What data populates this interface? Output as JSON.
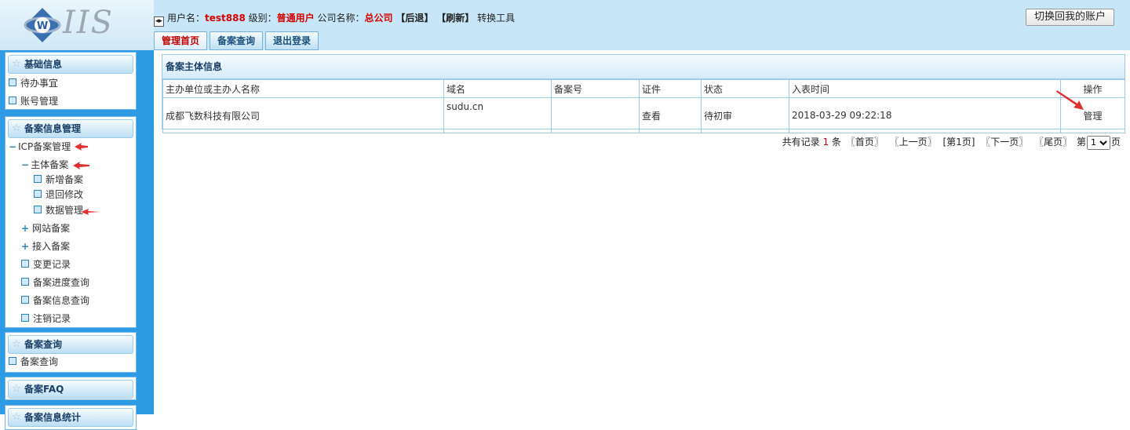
{
  "header": {
    "logo_text": "IIS",
    "user_label": "用户名：",
    "username": "test888",
    "level_label": "级别：",
    "level": "普通用户",
    "company_label": "公司名称：",
    "company": "总公司",
    "back": "【后退】",
    "refresh": "【刷新】",
    "convert": "转换工具",
    "switch_account": "切换回我的账户"
  },
  "tabs": [
    {
      "label": "管理首页"
    },
    {
      "label": "备案查询"
    },
    {
      "label": "退出登录"
    }
  ],
  "sidebar": {
    "basic": {
      "title": "基础信息",
      "items": [
        "待办事宜",
        "账号管理"
      ]
    },
    "record_mgmt": {
      "title": "备案信息管理",
      "icp": "ICP备案管理",
      "subject": "主体备案",
      "subject_children": [
        "新增备案",
        "退回修改",
        "数据管理"
      ],
      "others": [
        "网站备案",
        "接入备案",
        "变更记录",
        "备案进度查询",
        "备案信息查询",
        "注销记录"
      ]
    },
    "query": {
      "title": "备案查询",
      "item": "备案查询"
    },
    "faq": {
      "title": "备案FAQ"
    },
    "stats": {
      "title": "备案信息统计"
    }
  },
  "main": {
    "title": "备案主体信息",
    "columns": [
      "主办单位或主办人名称",
      "域名",
      "备案号",
      "证件",
      "状态",
      "入表时间",
      "操作"
    ],
    "rows": [
      {
        "name": "成都飞数科技有限公司",
        "domain": "sudu.cn",
        "record_no": "",
        "cert": "查看",
        "status": "待初审",
        "time": "2018-03-29 09:22:18",
        "action": "管理"
      }
    ]
  },
  "pager": {
    "total_prefix": "共有记录",
    "total": "1",
    "total_suffix": "条",
    "first": "〖首页〗",
    "prev": "〖上一页〗",
    "current": "[第1页]",
    "next": "〖下一页〗",
    "last": "〖尾页〗",
    "goto_prefix": "第",
    "goto_value": "1",
    "goto_suffix": "页"
  },
  "colors": {
    "sidebar_bg": "#2d9be4",
    "header_bg": "#c7e6f8",
    "accent_red": "#d40000",
    "arrow_red": "#e03030"
  }
}
